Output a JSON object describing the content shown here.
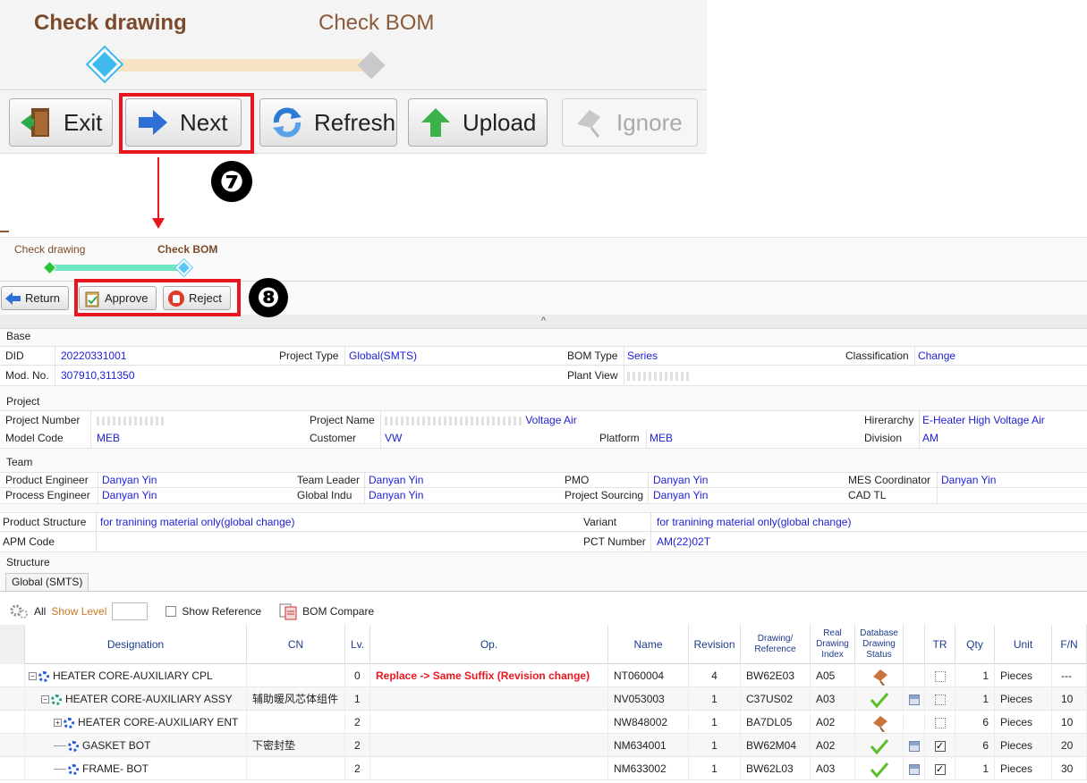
{
  "top_step": {
    "step1_label": "Check drawing",
    "step2_label": "Check BOM",
    "buttons": {
      "exit": "Exit",
      "next": "Next",
      "refresh": "Refresh",
      "upload": "Upload",
      "ignore": "Ignore"
    },
    "badge": "❼"
  },
  "second_step": {
    "step1_label": "Check drawing",
    "step2_label": "Check BOM",
    "buttons": {
      "return": "Return",
      "approve": "Approve",
      "reject": "Reject"
    },
    "badge": "❽",
    "collapse_glyph": "^"
  },
  "base": {
    "title": "Base",
    "did_label": "DID",
    "did_value": "20220331001",
    "project_type_label": "Project Type",
    "project_type_value": "Global(SMTS)",
    "bom_type_label": "BOM Type",
    "bom_type_value": "Series",
    "classification_label": "Classification",
    "classification_value": "Change",
    "mod_no_label": "Mod. No.",
    "mod_no_value": "307910,311350",
    "plant_view_label": "Plant View"
  },
  "project": {
    "title": "Project",
    "project_number_label": "Project Number",
    "project_name_label": "Project Name",
    "project_name_value": "Voltage Air",
    "hirerarchy_label": "Hirerarchy",
    "hirerarchy_value": "E-Heater High Voltage Air",
    "model_code_label": "Model Code",
    "model_code_value": "MEB",
    "customer_label": "Customer",
    "customer_value": "VW",
    "platform_label": "Platform",
    "platform_value": "MEB",
    "division_label": "Division",
    "division_value": "AM"
  },
  "team": {
    "title": "Team",
    "product_engineer_label": "Product Engineer",
    "product_engineer_value": "Danyan Yin",
    "team_leader_label": "Team Leader",
    "team_leader_value": "Danyan Yin",
    "pmo_label": "PMO",
    "pmo_value": "Danyan Yin",
    "mes_label": "MES Coordinator",
    "mes_value": "Danyan Yin",
    "process_engineer_label": "Process Engineer",
    "process_engineer_value": "Danyan Yin",
    "global_indu_label": "Global Indu",
    "global_indu_value": "Danyan Yin",
    "project_sourcing_label": "Project Sourcing",
    "project_sourcing_value": "Danyan Yin",
    "cad_tl_label": "CAD TL"
  },
  "product": {
    "product_structure_label": "Product Structure",
    "product_structure_value": "for tranining material only(global change)",
    "variant_label": "Variant",
    "variant_value": "for tranining material only(global change)",
    "apm_code_label": "APM Code",
    "pct_number_label": "PCT Number",
    "pct_number_value": "AM(22)02T"
  },
  "structure": {
    "title": "Structure",
    "tab_label": "Global (SMTS)",
    "all_label": "All",
    "show_level_label": "Show Level",
    "show_reference_label": "Show Reference",
    "bom_compare_label": "BOM Compare",
    "columns": {
      "designation": "Designation",
      "cn": "CN",
      "lv": "Lv.",
      "op": "Op.",
      "name": "Name",
      "revision": "Revision",
      "drawing_reference": "Drawing/ Reference",
      "real_drawing_index": "Real Drawing Index",
      "db_drawing_status": "Database Drawing Status",
      "tr": "TR",
      "qty": "Qty",
      "unit": "Unit",
      "fn": "F/N"
    },
    "rows": [
      {
        "designation": "HEATER CORE-AUXILIARY CPL",
        "cn": "",
        "lv": "0",
        "op": "Replace -> Same Suffix (Revision change)",
        "name": "NT060004",
        "revision": "4",
        "drawing": "BW62E03",
        "index": "A05",
        "status": "flag",
        "doc": false,
        "tr": "box",
        "qty": "1",
        "unit": "Pieces",
        "fn": "---"
      },
      {
        "designation": "HEATER CORE-AUXILIARY ASSY",
        "cn": "辅助暖风芯体组件",
        "lv": "1",
        "op": "",
        "name": "NV053003",
        "revision": "1",
        "drawing": "C37US02",
        "index": "A03",
        "status": "check",
        "doc": true,
        "tr": "box",
        "qty": "1",
        "unit": "Pieces",
        "fn": "10"
      },
      {
        "designation": "HEATER CORE-AUXILIARY ENT",
        "cn": "",
        "lv": "2",
        "op": "",
        "name": "NW848002",
        "revision": "1",
        "drawing": "BA7DL05",
        "index": "A02",
        "status": "flag",
        "doc": false,
        "tr": "box",
        "qty": "6",
        "unit": "Pieces",
        "fn": "10"
      },
      {
        "designation": "GASKET BOT",
        "cn": "下密封垫",
        "lv": "2",
        "op": "",
        "name": "NM634001",
        "revision": "1",
        "drawing": "BW62M04",
        "index": "A02",
        "status": "check",
        "doc": true,
        "tr": "check",
        "qty": "6",
        "unit": "Pieces",
        "fn": "20"
      },
      {
        "designation": "FRAME- BOT",
        "cn": "",
        "lv": "2",
        "op": "",
        "name": "NM633002",
        "revision": "1",
        "drawing": "BW62L03",
        "index": "A03",
        "status": "check",
        "doc": true,
        "tr": "check",
        "qty": "1",
        "unit": "Pieces",
        "fn": "30"
      }
    ]
  },
  "colors": {
    "highlight": "#e8171f",
    "value_blue": "#2020d8",
    "header_blue": "#1a3c8a",
    "step_brown": "#7b4a2a"
  }
}
